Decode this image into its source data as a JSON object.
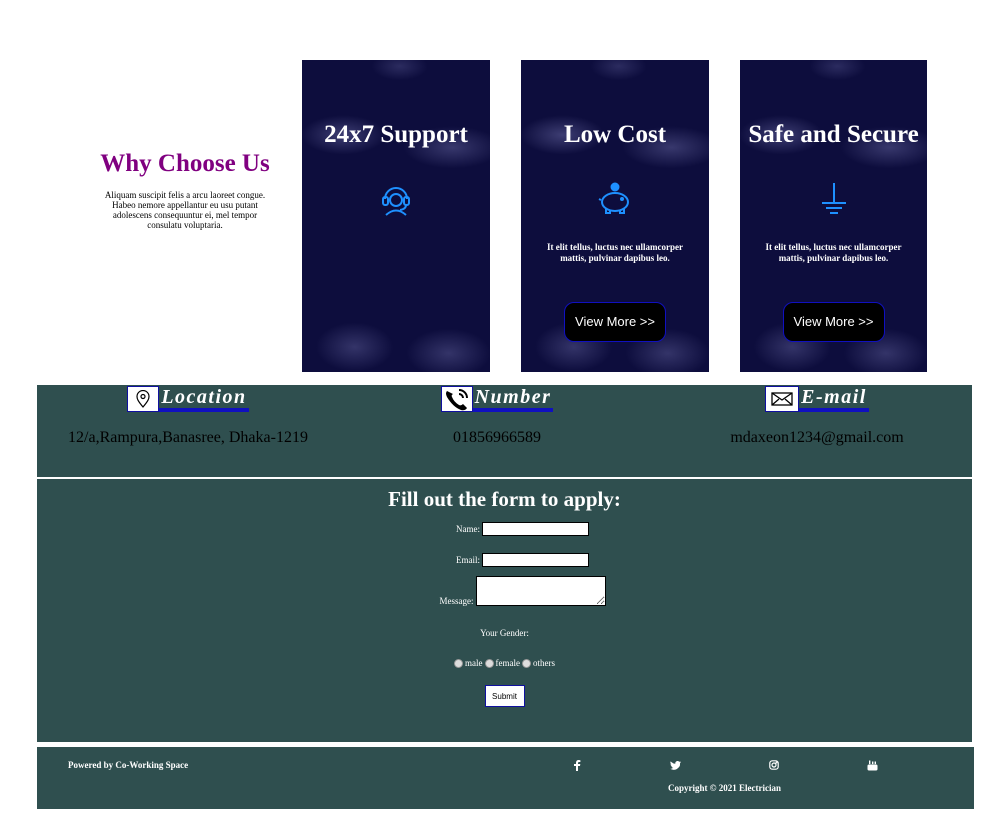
{
  "why": {
    "title": "Why Choose Us",
    "text": "Aliquam suscipit felis a arcu laoreet congue. Habeo nemore appellantur eu usu putant adolescens consequuntur ei, mel tempor consulatu voluptaria."
  },
  "cards": [
    {
      "title": "24x7 Support",
      "icon": "headset-icon",
      "text": "",
      "button": ""
    },
    {
      "title": "Low Cost",
      "icon": "piggy-bank-icon",
      "text": "It elit tellus, luctus nec ullamcorper mattis, pulvinar dapibus leo.",
      "button": "View More >>"
    },
    {
      "title": "Safe and Secure",
      "icon": "ground-icon",
      "text": "It elit tellus, luctus nec ullamcorper mattis, pulvinar dapibus leo.",
      "button": "View More >>"
    }
  ],
  "contact": {
    "location": {
      "label": "Location",
      "value": "12/a,Rampura,Banasree, Dhaka-1219",
      "icon": "location-pin-icon"
    },
    "number": {
      "label": "Number",
      "value": "01856966589",
      "icon": "phone-icon"
    },
    "email": {
      "label": "E-mail",
      "value": "mdaxeon1234@gmail.com",
      "icon": "envelope-icon"
    }
  },
  "form": {
    "title": "Fill out the form to apply:",
    "name_label": "Name:",
    "email_label": "Email:",
    "message_label": "Message:",
    "gender_label": "Your Gender:",
    "gender_options": [
      "male",
      "female",
      "others"
    ],
    "submit_label": "Submit"
  },
  "footer": {
    "powered": "Powered by Co-Working Space",
    "copyright": "Copyright © 2021 Electrician",
    "social": [
      "facebook-icon",
      "twitter-icon",
      "instagram-icon",
      "youtube-icon"
    ]
  },
  "colors": {
    "accent_purple": "#800080",
    "card_bg": "#0d0d3d",
    "icon_blue": "#1e90ff",
    "panel_bg": "#2f4f4f",
    "underline_blue": "#1010c0"
  }
}
